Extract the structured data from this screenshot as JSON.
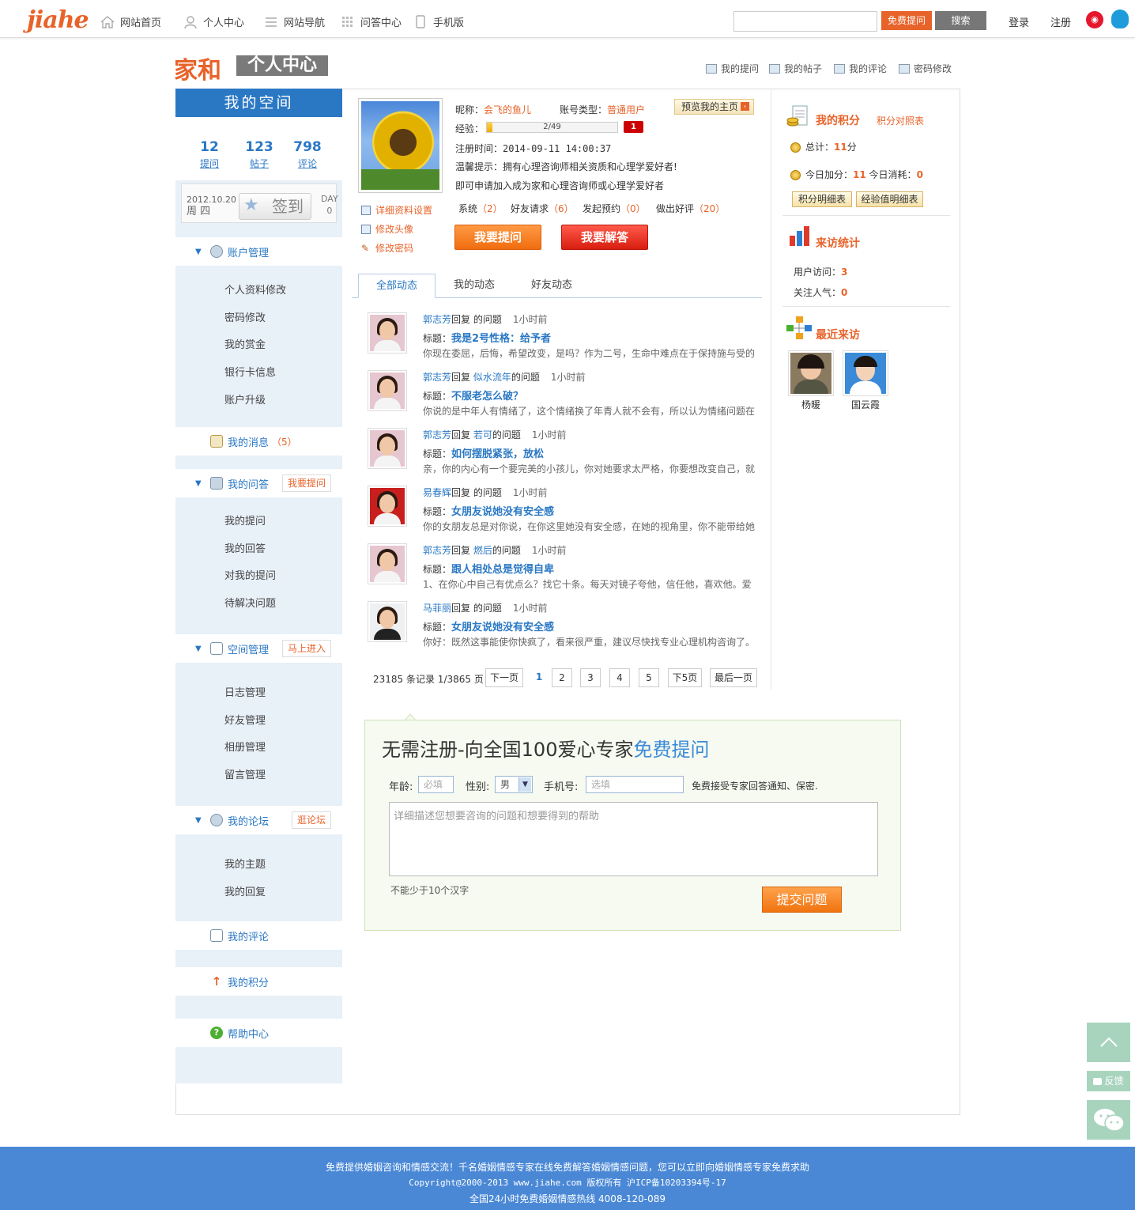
{
  "topbar": {
    "logo": "jiahe",
    "nav": [
      {
        "label": "网站首页",
        "icon": "home-icon"
      },
      {
        "label": "个人中心",
        "icon": "user-icon"
      },
      {
        "label": "网站导航",
        "icon": "list-icon"
      },
      {
        "label": "问答中心",
        "icon": "grid-icon"
      },
      {
        "label": "手机版",
        "icon": "phone-icon"
      }
    ],
    "search_placeholder": "",
    "free_ask": "免费提问",
    "search": "搜索",
    "login": "登录",
    "register": "注册"
  },
  "brand": {
    "name": "家和",
    "section": "个人中心"
  },
  "top_links": [
    "我的提问",
    "我的帖子",
    "我的评论",
    "密码修改"
  ],
  "sidebar": {
    "title": "我的空间",
    "stats": [
      {
        "value": "12",
        "label": "提问"
      },
      {
        "value": "123",
        "label": "帖子"
      },
      {
        "value": "798",
        "label": "评论"
      }
    ],
    "sign": {
      "date": "2012.10.20",
      "weekday": "周 四",
      "button": "签到",
      "day_label": "DAY",
      "day_value": "0"
    },
    "account": {
      "title": "账户管理",
      "items": [
        "个人资料修改",
        "密码修改",
        "我的赏金",
        "银行卡信息",
        "账户升级"
      ]
    },
    "messages": {
      "title": "我的消息",
      "count": "（5）"
    },
    "questions": {
      "title": "我的问答",
      "tag": "我要提问",
      "items": [
        "我的提问",
        "我的回答",
        "对我的提问",
        "待解决问题"
      ]
    },
    "space": {
      "title": "空间管理",
      "tag": "马上进入",
      "items": [
        "日志管理",
        "好友管理",
        "相册管理",
        "留言管理"
      ]
    },
    "forum": {
      "title": "我的论坛",
      "tag": "逛论坛",
      "items": [
        "我的主题",
        "我的回复"
      ]
    },
    "comments": {
      "title": "我的评论"
    },
    "points": {
      "title": "我的积分"
    },
    "help": {
      "title": "帮助中心"
    }
  },
  "profile": {
    "nickname_label": "昵称：",
    "nickname": "会飞的鱼儿",
    "account_type_label": "账号类型：",
    "account_type": "普通用户",
    "preview": "预览我的主页",
    "exp_label": "经验：",
    "exp_text": "2/49",
    "exp_fraction": 0.04,
    "level": "1",
    "register_time": "注册时间：2014-09-11 14:00:37",
    "tip1": "温馨提示：拥有心理咨询师相关资质和心理学爱好者!",
    "tip2": "即可申请加入成为家和心理咨询师或心理学爱好者",
    "counters": [
      {
        "label": "系统",
        "value": "（2）"
      },
      {
        "label": "好友请求",
        "value": "（6）"
      },
      {
        "label": "发起预约",
        "value": "（0）"
      },
      {
        "label": "做出好评",
        "value": "（20）"
      }
    ],
    "links": [
      "详细资料设置",
      "修改头像",
      "修改密码"
    ],
    "ask_button": "我要提问",
    "answer_button": "我要解答"
  },
  "tabs": [
    "全部动态",
    "我的动态",
    "好友动态"
  ],
  "feed": [
    {
      "user": "郭志芳",
      "action": "回复",
      "target": "",
      "suffix": "的问题",
      "time": "1小时前",
      "title_label": "标题：",
      "title": "我是2号性格：给予者",
      "excerpt": "你现在委屈，后悔，希望改变，是吗？作为二号，生命中难点在于保持施与受的"
    },
    {
      "user": "郭志芳",
      "action": "回复",
      "target": "似水流年",
      "suffix": "的问题",
      "time": "1小时前",
      "title_label": "标题：",
      "title": "不服老怎么破？",
      "excerpt": "你说的是中年人有情绪了，这个情绪换了年青人就不会有，所以认为情绪问题在"
    },
    {
      "user": "郭志芳",
      "action": "回复",
      "target": "若可",
      "suffix": "的问题",
      "time": "1小时前",
      "title_label": "标题：",
      "title": "如何摆脱紧张，放松",
      "excerpt": "亲，你的内心有一个要完美的小孩儿，你对她要求太严格，你要想改变自己，就"
    },
    {
      "user": "易春辉",
      "action": "回复",
      "target": "",
      "suffix": "的问题",
      "time": "1小时前",
      "title_label": "标题：",
      "title": "女朋友说她没有安全感",
      "excerpt": "你的女朋友总是对你说，在你这里她没有安全感，在她的视角里，你不能带给她"
    },
    {
      "user": "郭志芳",
      "action": "回复",
      "target": "燃后",
      "suffix": "的问题",
      "time": "1小时前",
      "title_label": "标题：",
      "title": "跟人相处总是觉得自卑",
      "excerpt": "1、在你心中自己有优点么？找它十条。每天对镜子夸他，信任他，喜欢他。爱"
    },
    {
      "user": "马菲丽",
      "action": "回复",
      "target": "",
      "suffix": "的问题",
      "time": "1小时前",
      "title_label": "标题：",
      "title": "女朋友说她没有安全感",
      "excerpt": "你好：既然这事能使你快疯了，看来很严重，建议尽快找专业心理机构咨询了。"
    }
  ],
  "pager": {
    "info": "23185 条记录 1/3865 页",
    "prev": "下一页",
    "pages": [
      "1",
      "2",
      "3",
      "4",
      "5"
    ],
    "next5": "下5页",
    "last": "最后一页"
  },
  "right": {
    "points_title": "我的积分",
    "points_table": "积分对照表",
    "total_label": "总计：",
    "total_value": "11",
    "total_unit": "分",
    "today_add_label": "今日加分：",
    "today_add": "11",
    "today_use_label": "今日消耗：",
    "today_use": "0",
    "btn_points": "积分明细表",
    "btn_exp": "经验值明细表",
    "visit_title": "来访统计",
    "user_visits_label": "用户访问：",
    "user_visits": "3",
    "popularity_label": "关注人气：",
    "popularity": "0",
    "recent_title": "最近来访",
    "visitors": [
      "杨暖",
      "国云霞"
    ]
  },
  "qform": {
    "title_main": "无需注册-向全国100爱心专家",
    "title_accent": "免费提问",
    "age_label": "年龄:",
    "age_placeholder": "必填",
    "gender_label": "性别:",
    "gender_value": "男",
    "phone_label": "手机号:",
    "phone_placeholder": "选填",
    "notice": "免费接受专家回答通知、保密.",
    "textarea_placeholder": "详细描述您想要咨询的问题和想要得到的帮助",
    "hint": "不能少于10个汉字",
    "submit": "提交问题"
  },
  "float": {
    "feedback": "反馈"
  },
  "footer": {
    "line1": "免费提供婚姻咨询和情感交流！千名婚姻情感专家在线免费解答婚姻情感问题，您可以立即向婚姻情感专家免费求助",
    "line2": "Copyright@2000-2013  www.jiahe.com  版权所有 沪ICP备10203394号-17",
    "line3": "全国24小时免费婚姻情感热线 4008-120-089"
  },
  "colors": {
    "accent": "#e8632a",
    "link": "#2a78c4",
    "footer": "#4a88d6"
  }
}
